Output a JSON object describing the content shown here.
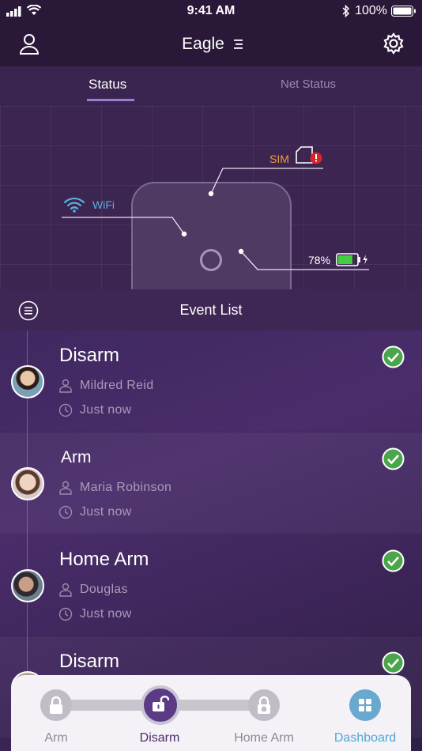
{
  "status_bar": {
    "time": "9:41 AM",
    "battery": "100%"
  },
  "header": {
    "title": "Eagle"
  },
  "tabs": [
    {
      "label": "Status"
    },
    {
      "label": "Net Status"
    }
  ],
  "device": {
    "sim_label": "SIM",
    "wifi_label": "WiFi",
    "battery_label": "78%",
    "battery_level": 0.78,
    "colors": {
      "sim": "#f09a3e",
      "wifi": "#5bb0e0",
      "battery": "#3fcf3f",
      "alert": "#d9252a"
    }
  },
  "event_list": {
    "title": "Event List",
    "events": [
      {
        "action": "Disarm",
        "user": "Mildred Reid",
        "time": "Just now"
      },
      {
        "action": "Arm",
        "user": "Maria Robinson",
        "time": "Just now"
      },
      {
        "action": "Home Arm",
        "user": "Douglas",
        "time": "Just now"
      },
      {
        "action": "Disarm"
      }
    ]
  },
  "bottom_bar": {
    "arm_label": "Arm",
    "disarm_label": "Disarm",
    "home_arm_label": "Home Arm",
    "dashboard_label": "Dashboard",
    "selected": "Disarm",
    "accent": "#4fa7d6",
    "active_color": "#5b3b85"
  }
}
